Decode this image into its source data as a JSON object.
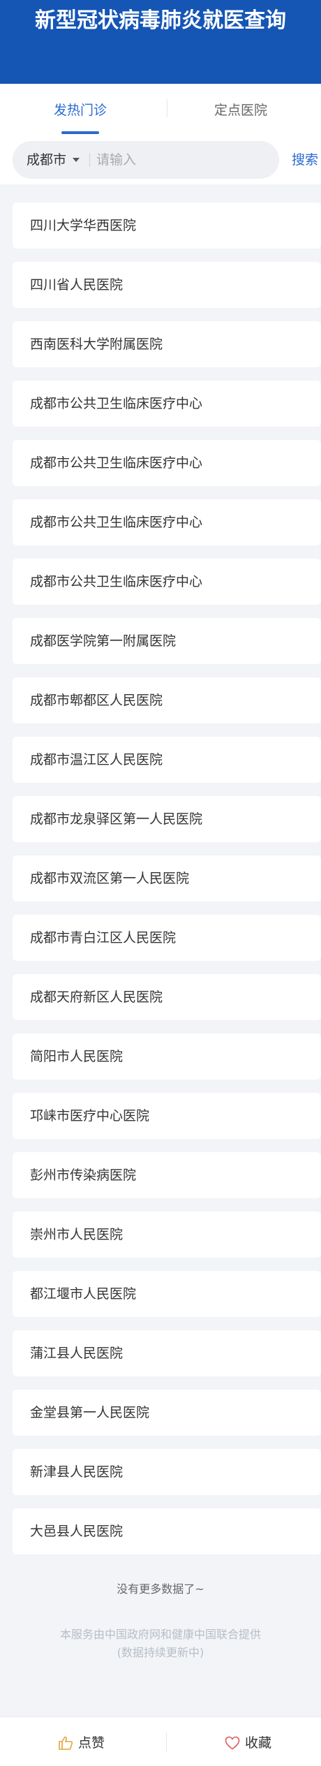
{
  "header": {
    "title": "新型冠状病毒肺炎就医查询"
  },
  "tabs": [
    {
      "label": "发热门诊",
      "active": true
    },
    {
      "label": "定点医院",
      "active": false
    }
  ],
  "search": {
    "city": "成都市",
    "placeholder": "请输入",
    "value": "",
    "button_label": "搜索"
  },
  "hospitals": [
    "四川大学华西医院",
    "四川省人民医院",
    "西南医科大学附属医院",
    "成都市公共卫生临床医疗中心",
    "成都市公共卫生临床医疗中心",
    "成都市公共卫生临床医疗中心",
    "成都市公共卫生临床医疗中心",
    "成都医学院第一附属医院",
    "成都市郫都区人民医院",
    "成都市温江区人民医院",
    "成都市龙泉驿区第一人民医院",
    "成都市双流区第一人民医院",
    "成都市青白江区人民医院",
    "成都天府新区人民医院",
    "简阳市人民医院",
    "邛崃市医疗中心医院",
    "彭州市传染病医院",
    "崇州市人民医院",
    "都江堰市人民医院",
    "蒲江县人民医院",
    "金堂县第一人民医院",
    "新津县人民医院",
    "大邑县人民医院"
  ],
  "list_end": "没有更多数据了~",
  "credit": {
    "line1": "本服务由中国政府网和健康中国联合提供",
    "line2": "(数据持续更新中)"
  },
  "footer": {
    "like_label": "点赞",
    "favorite_label": "收藏",
    "like_icon": "thumbs-up-icon",
    "favorite_icon": "heart-icon"
  },
  "colors": {
    "brand": "#1556b5",
    "accent": "#2a6ad2",
    "like_icon": "#e6a23c",
    "favorite_icon": "#e05a5a"
  }
}
